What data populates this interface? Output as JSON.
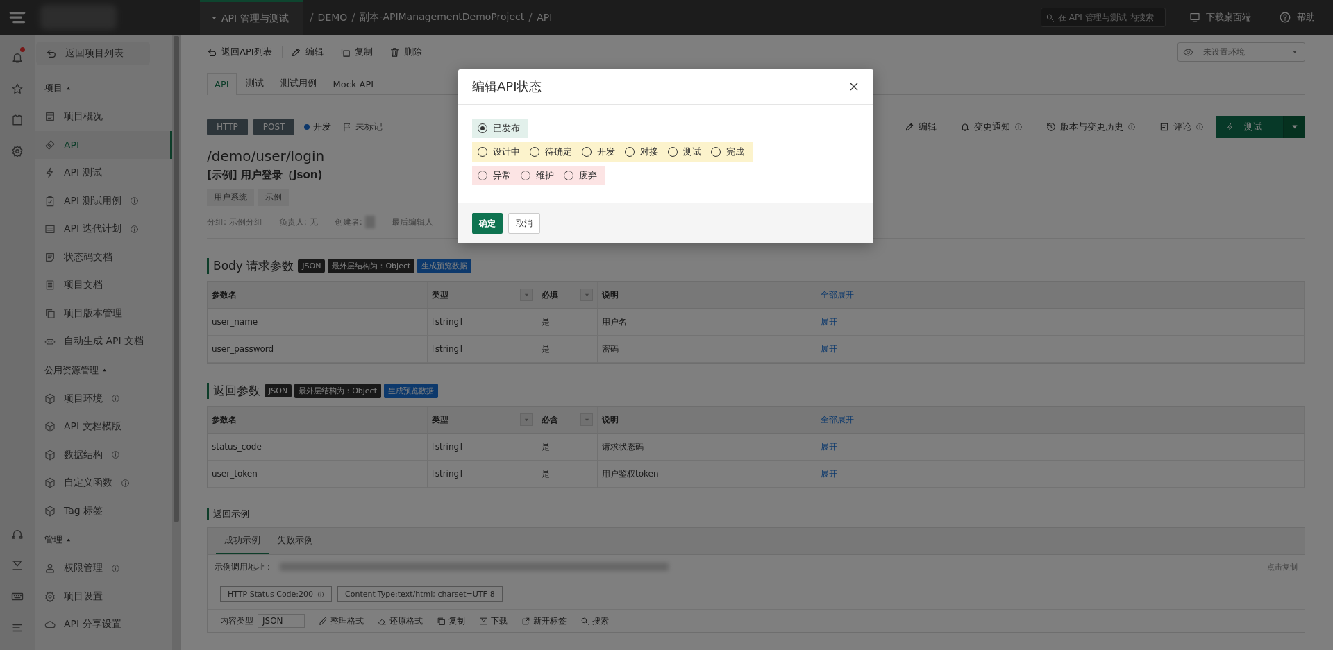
{
  "top_bar": {
    "project_menu": "API 管理与测试",
    "breadcrumb": [
      {
        "label": "DEMO"
      },
      {
        "label": "副本-APIManagementDemoProject"
      },
      {
        "label": "API"
      }
    ],
    "search": {
      "placeholder": "在 API 管理与测试 内搜索"
    },
    "download": "下载桌面端",
    "help": "帮助"
  },
  "sidebar": {
    "back": "返回项目列表",
    "sections": [
      {
        "title": "项目",
        "expanded": true,
        "items": [
          {
            "label": "项目概况",
            "info": false,
            "selected": false
          },
          {
            "label": "API",
            "info": false,
            "selected": true
          },
          {
            "label": "API 测试",
            "info": false,
            "selected": false
          },
          {
            "label": "API 测试用例",
            "info": true,
            "selected": false
          },
          {
            "label": "API 迭代计划",
            "info": true,
            "selected": false
          },
          {
            "label": "状态码文档",
            "info": false,
            "selected": false
          },
          {
            "label": "项目文档",
            "info": false,
            "selected": false
          },
          {
            "label": "项目版本管理",
            "info": false,
            "selected": false
          },
          {
            "label": "自动生成 API 文档",
            "info": false,
            "selected": false
          }
        ]
      },
      {
        "title": "公用资源管理",
        "expanded": true,
        "items": [
          {
            "label": "项目环境",
            "info": true,
            "selected": false
          },
          {
            "label": "API 文档模版",
            "info": false,
            "selected": false
          },
          {
            "label": "数据结构",
            "info": true,
            "selected": false
          },
          {
            "label": "自定义函数",
            "info": true,
            "selected": false
          },
          {
            "label": "Tag 标签",
            "info": false,
            "selected": false
          }
        ]
      },
      {
        "title": "管理",
        "expanded": true,
        "items": [
          {
            "label": "权限管理",
            "info": true,
            "selected": false
          },
          {
            "label": "项目设置",
            "info": false,
            "selected": false
          },
          {
            "label": "API 分享设置",
            "info": false,
            "selected": false
          }
        ]
      }
    ]
  },
  "api_toolbar": [
    {
      "label": "返回API列表"
    },
    {
      "label": "编辑"
    },
    {
      "label": "复制"
    },
    {
      "label": "删除"
    }
  ],
  "environment": {
    "placeholder": "未设置环境"
  },
  "tabs": [
    {
      "label": "API",
      "selected": true
    },
    {
      "label": "测试",
      "selected": false
    },
    {
      "label": "测试用例",
      "selected": false
    },
    {
      "label": "Mock API",
      "selected": false
    }
  ],
  "api": {
    "protocol": "HTTP",
    "method": "POST",
    "status": "开发",
    "mark": "未标记",
    "path": "/demo/user/login",
    "name": "[示例] 用户登录（Json)",
    "tags": [
      "用户系统",
      "示例"
    ],
    "meta": [
      "分组: 示例分组",
      "负责人: 无",
      "创建者:",
      "最后编辑人"
    ]
  },
  "actions": [
    {
      "label": "编辑",
      "info": false
    },
    {
      "label": "变更通知",
      "info": true
    },
    {
      "label": "版本与变更历史",
      "info": true
    },
    {
      "label": "评论",
      "info": true
    }
  ],
  "test_button": "测试",
  "request_params": {
    "title": "Body 请求参数",
    "badges": [
      {
        "label": "JSON",
        "kind": "dark"
      },
      {
        "label": "最外层结构为：Object",
        "kind": "dark"
      },
      {
        "label": "生成预览数据",
        "kind": "link"
      }
    ],
    "columns": [
      {
        "label": "参数名",
        "filter": false,
        "kind": "text"
      },
      {
        "label": "类型",
        "filter": true,
        "kind": "text"
      },
      {
        "label": "必填",
        "filter": true,
        "kind": "text"
      },
      {
        "label": "说明",
        "filter": false,
        "kind": "text"
      },
      {
        "label": "全部展开",
        "filter": false,
        "kind": "link"
      }
    ],
    "rows": [
      [
        "user_name",
        "[string]",
        "是",
        "用户名",
        "展开"
      ],
      [
        "user_password",
        "[string]",
        "是",
        "密码",
        "展开"
      ]
    ]
  },
  "response_params": {
    "title": "返回参数",
    "badges": [
      {
        "label": "JSON",
        "kind": "dark"
      },
      {
        "label": "最外层结构为：Object",
        "kind": "dark"
      },
      {
        "label": "生成预览数据",
        "kind": "link"
      }
    ],
    "columns": [
      {
        "label": "参数名",
        "filter": false,
        "kind": "text"
      },
      {
        "label": "类型",
        "filter": true,
        "kind": "text"
      },
      {
        "label": "必含",
        "filter": true,
        "kind": "text"
      },
      {
        "label": "说明",
        "filter": false,
        "kind": "text"
      },
      {
        "label": "全部展开",
        "filter": false,
        "kind": "link"
      }
    ],
    "rows": [
      [
        "status_code",
        "[string]",
        "是",
        "请求状态码",
        "展开"
      ],
      [
        "user_token",
        "[string]",
        "是",
        "用户鉴权token",
        "展开"
      ]
    ]
  },
  "response_example": {
    "title": "返回示例",
    "tabs": [
      {
        "label": "成功示例",
        "selected": true
      },
      {
        "label": "失败示例",
        "selected": false
      }
    ],
    "url_label": "示例调用地址：",
    "copy": "点击复制",
    "chips": [
      {
        "label": "HTTP Status Code:200",
        "info": true
      },
      {
        "label": "Content-Type:text/html; charset=UTF-8",
        "info": false
      }
    ],
    "content_type_label": "内容类型",
    "content_type": "JSON",
    "tools": [
      {
        "label": "整理格式"
      },
      {
        "label": "还原格式"
      },
      {
        "label": "复制"
      },
      {
        "label": "下载"
      },
      {
        "label": "新开标签"
      },
      {
        "label": "搜索"
      }
    ]
  },
  "modal": {
    "title": "编辑API状态",
    "groups": [
      {
        "color": "#e2f0eb",
        "options": [
          {
            "label": "已发布",
            "selected": true
          }
        ]
      },
      {
        "color": "#fcf3cc",
        "options": [
          {
            "label": "设计中",
            "selected": false
          },
          {
            "label": "待确定",
            "selected": false
          },
          {
            "label": "开发",
            "selected": false
          },
          {
            "label": "对接",
            "selected": false
          },
          {
            "label": "测试",
            "selected": false
          },
          {
            "label": "完成",
            "selected": false
          }
        ]
      },
      {
        "color": "#fce4e4",
        "options": [
          {
            "label": "异常",
            "selected": false
          },
          {
            "label": "维护",
            "selected": false
          },
          {
            "label": "废弃",
            "selected": false
          }
        ]
      }
    ],
    "confirm": "确定",
    "cancel": "取消"
  }
}
